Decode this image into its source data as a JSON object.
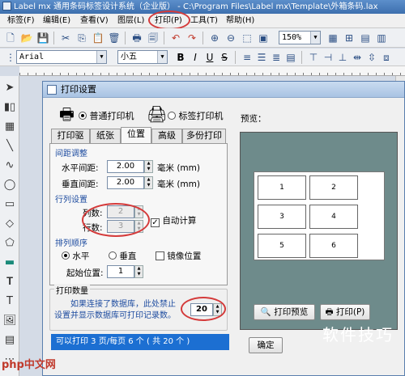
{
  "window": {
    "title": "Label mx 通用条码标签设计系统（企业版） - C:\\Program Files\\Label mx\\Template\\外箱条码.lax"
  },
  "menu": [
    {
      "label": "标签(F)"
    },
    {
      "label": "编辑(E)"
    },
    {
      "label": "查看(V)"
    },
    {
      "label": "图层(L)"
    },
    {
      "label": "打印(P)"
    },
    {
      "label": "工具(T)"
    },
    {
      "label": "帮助(H)"
    }
  ],
  "toolbar": {
    "zoom_value": "150%",
    "font_name": "Arial",
    "font_size": "小五",
    "bold_label": "B",
    "italic_label": "I",
    "underline_label": "U",
    "strike_label": "S"
  },
  "dialog": {
    "title": "打印设置",
    "printer_normal": "普通打印机",
    "printer_label": "标签打印机",
    "tabs": [
      "打印驱动",
      "纸张",
      "位置",
      "高级",
      "多份打印"
    ],
    "active_tab": "位置",
    "spacing": {
      "title": "间距调整",
      "h_label": "水平间距:",
      "h_value": "2.00",
      "v_label": "垂直间距:",
      "v_value": "2.00",
      "unit": "毫米 (mm)"
    },
    "rowcol": {
      "title": "行列设置",
      "cols_label": "列数:",
      "cols_value": "2",
      "rows_label": "行数:",
      "rows_value": "3",
      "auto_calc": "自动计算"
    },
    "order": {
      "title": "排列顺序",
      "horizontal": "水平",
      "vertical": "垂直",
      "mirror": "镜像位置",
      "start_label": "起始位置:",
      "start_value": "1"
    },
    "print_count": {
      "title": "打印数量",
      "note_line1": "如果连接了数据库，此处禁止",
      "note_line2": "设置并显示数据库可打印记录数。",
      "value": "20"
    },
    "status": "可以打印 3 页/每页 6 个 ( 共 20 个 )",
    "preview_label": "预览：",
    "preview_cells": [
      "1",
      "2",
      "3",
      "4",
      "5",
      "6"
    ],
    "print_preview_button": "打印预览",
    "print_button": "打印(P)",
    "ok_button": "确定"
  },
  "watermark": {
    "text": "软件技巧",
    "logo": "php中文网"
  }
}
